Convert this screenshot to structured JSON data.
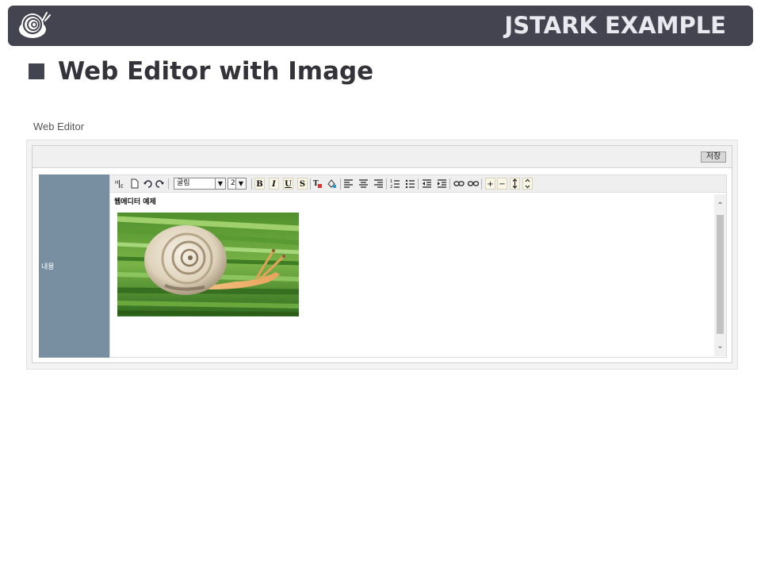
{
  "header": {
    "brand": "JSTARK EXAMPLE",
    "logo_icon": "snail-logo-icon",
    "bar_color": "#434450"
  },
  "page": {
    "title": "Web Editor with Image"
  },
  "editor_section": {
    "label": "Web Editor",
    "save_label": "저장",
    "row_label": "내용",
    "row_label_color": "#778fa1",
    "toolbar": {
      "font_family": "굴림",
      "font_size": "2",
      "bold": "B",
      "italic": "I",
      "underline": "U",
      "strike": "S",
      "increase": "+",
      "decrease": "−"
    },
    "content_title": "웹에디터 예제",
    "image_icon": "snail-photo"
  }
}
